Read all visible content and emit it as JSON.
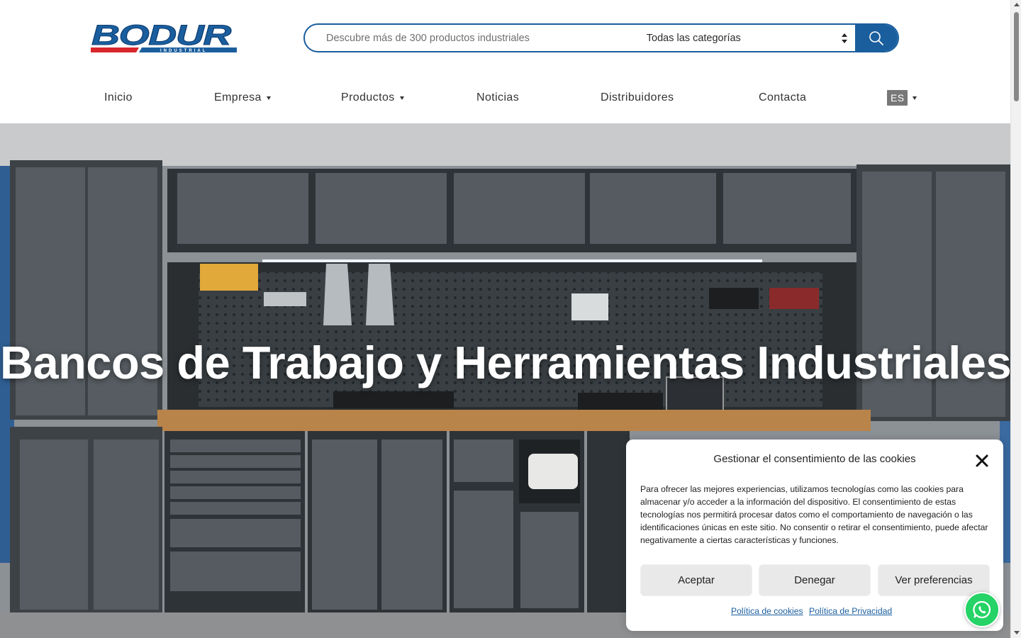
{
  "brand": {
    "logo_text": "BODUR",
    "logo_subtext": "INDUSTRIAL",
    "color_primary": "#1a5e9e",
    "color_accent": "#d8262c"
  },
  "search": {
    "placeholder": "Descubre más de 300 productos industriales",
    "value": "",
    "category_selected": "Todas las categorías",
    "button_icon": "search-icon"
  },
  "nav": {
    "items": [
      {
        "label": "Inicio",
        "has_dropdown": false
      },
      {
        "label": "Empresa",
        "has_dropdown": true
      },
      {
        "label": "Productos",
        "has_dropdown": true
      },
      {
        "label": "Noticias",
        "has_dropdown": false
      },
      {
        "label": "Distribuidores",
        "has_dropdown": false
      },
      {
        "label": "Contacta",
        "has_dropdown": false
      }
    ],
    "language": "ES"
  },
  "hero": {
    "title": "Bancos de Trabajo y Herramientas Industriales"
  },
  "cookie_dialog": {
    "title": "Gestionar el consentimiento de las cookies",
    "body": "Para ofrecer las mejores experiencias, utilizamos tecnologías como las cookies para almacenar y/o acceder a la información del dispositivo. El consentimiento de estas tecnologías nos permitirá procesar datos como el comportamiento de navegación o las identificaciones únicas en este sitio. No consentir o retirar el consentimiento, puede afectar negativamente a ciertas características y funciones.",
    "buttons": {
      "accept": "Aceptar",
      "deny": "Denegar",
      "preferences": "Ver preferencias"
    },
    "links": {
      "cookies_policy": "Política de cookies",
      "privacy_policy": "Política de Privacidad"
    }
  },
  "floating": {
    "whatsapp_icon": "whatsapp-icon"
  }
}
